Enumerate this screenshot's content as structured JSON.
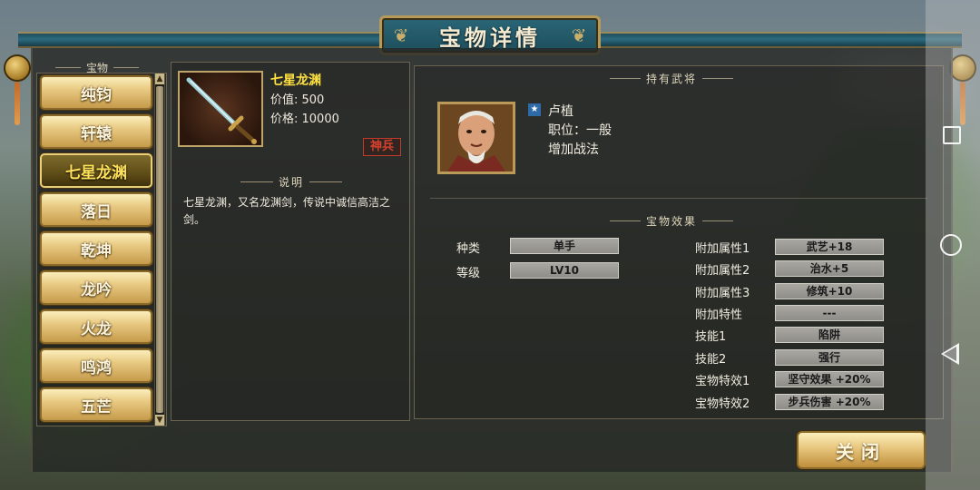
{
  "window": {
    "title": "宝物详情"
  },
  "list": {
    "header": "宝物",
    "items": [
      {
        "label": "纯钧",
        "selected": false
      },
      {
        "label": "轩辕",
        "selected": false
      },
      {
        "label": "七星龙渊",
        "selected": true
      },
      {
        "label": "落日",
        "selected": false
      },
      {
        "label": "乾坤",
        "selected": false
      },
      {
        "label": "龙吟",
        "selected": false
      },
      {
        "label": "火龙",
        "selected": false
      },
      {
        "label": "鸣鸿",
        "selected": false
      },
      {
        "label": "五芒",
        "selected": false
      }
    ]
  },
  "item": {
    "name": "七星龙渊",
    "value_label": "价值: ",
    "value": "500",
    "price_label": "价格: ",
    "price": "10000",
    "rank_stamp": "神兵",
    "description_header": "说明",
    "description": "七星龙渊，又名龙渊剑，传说中诚信高洁之剑。"
  },
  "holder": {
    "header": "持有武将",
    "name": "卢植",
    "position_label": "职位：",
    "position": "一般",
    "tactic": "增加战法"
  },
  "effects": {
    "header": "宝物效果",
    "left": [
      {
        "label": "种类",
        "value": "单手"
      },
      {
        "label": "等级",
        "value": "LV10"
      }
    ],
    "right": [
      {
        "label": "附加属性1",
        "value": "武艺+18"
      },
      {
        "label": "附加属性2",
        "value": "治水+5"
      },
      {
        "label": "附加属性3",
        "value": "修筑+10"
      },
      {
        "label": "附加特性",
        "value": "---"
      },
      {
        "label": "技能1",
        "value": "陷阱"
      },
      {
        "label": "技能2",
        "value": "强行"
      },
      {
        "label": "宝物特效1",
        "value": "坚守效果 +20%"
      },
      {
        "label": "宝物特效2",
        "value": "步兵伤害 +20%"
      }
    ]
  },
  "buttons": {
    "close": "关闭"
  },
  "colors": {
    "selected_text": "#ffe25a",
    "item_name": "#ffe140",
    "stamp": "#d8412e",
    "panel_teal": "#2a6677"
  }
}
